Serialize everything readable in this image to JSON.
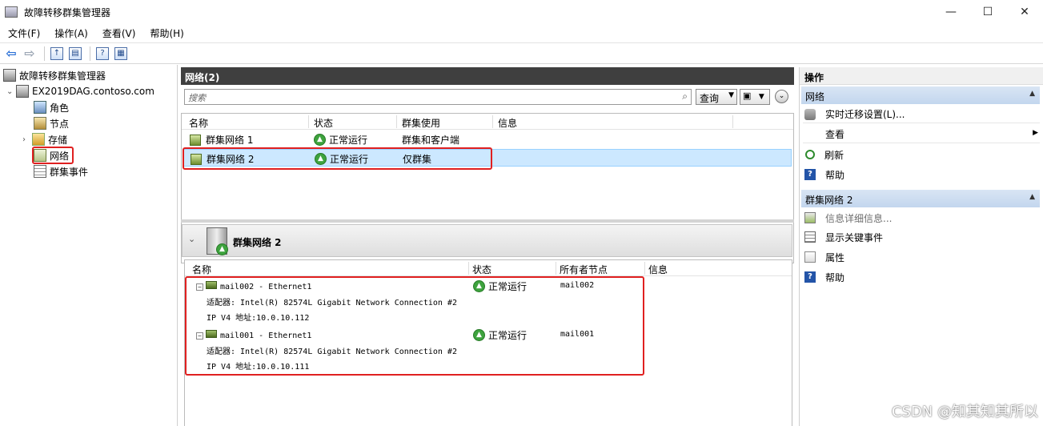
{
  "window": {
    "title": "故障转移群集管理器",
    "controls": [
      "minimize-icon",
      "maximize-icon",
      "close-icon"
    ]
  },
  "menu": [
    "文件(F)",
    "操作(A)",
    "查看(V)",
    "帮助(H)"
  ],
  "tree": {
    "root": "故障转移群集管理器",
    "cluster": "EX2019DAG.contoso.com",
    "children": [
      "角色",
      "节点",
      "存储",
      "网络",
      "群集事件"
    ]
  },
  "center": {
    "header": "网络(2)",
    "search_placeholder": "搜索",
    "query_label": "查询",
    "columns": [
      "名称",
      "状态",
      "群集使用",
      "信息"
    ],
    "rows": [
      {
        "name": "群集网络 1",
        "status": "正常运行",
        "use": "群集和客户端",
        "info": ""
      },
      {
        "name": "群集网络 2",
        "status": "正常运行",
        "use": "仅群集",
        "info": ""
      }
    ],
    "details": {
      "title": "群集网络 2",
      "columns": [
        "名称",
        "状态",
        "所有者节点",
        "信息"
      ],
      "items": [
        {
          "name": "mail002 - Ethernet1",
          "adapter": "适配器: Intel(R) 82574L Gigabit Network Connection #2",
          "ip": "IP V4 地址:10.0.10.112",
          "status": "正常运行",
          "owner": "mail002"
        },
        {
          "name": "mail001 - Ethernet1",
          "adapter": "适配器: Intel(R) 82574L Gigabit Network Connection #2",
          "ip": "IP V4 地址:10.0.10.111",
          "status": "正常运行",
          "owner": "mail001"
        }
      ]
    }
  },
  "actions": {
    "header": "操作",
    "section1": {
      "title": "网络",
      "items": [
        "实时迁移设置(L)...",
        "查看",
        "刷新",
        "帮助"
      ]
    },
    "section2": {
      "title": "群集网络 2",
      "items": [
        "信息详细信息...",
        "显示关键事件",
        "属性",
        "帮助"
      ]
    }
  },
  "watermark": "CSDN @知其知其所以"
}
